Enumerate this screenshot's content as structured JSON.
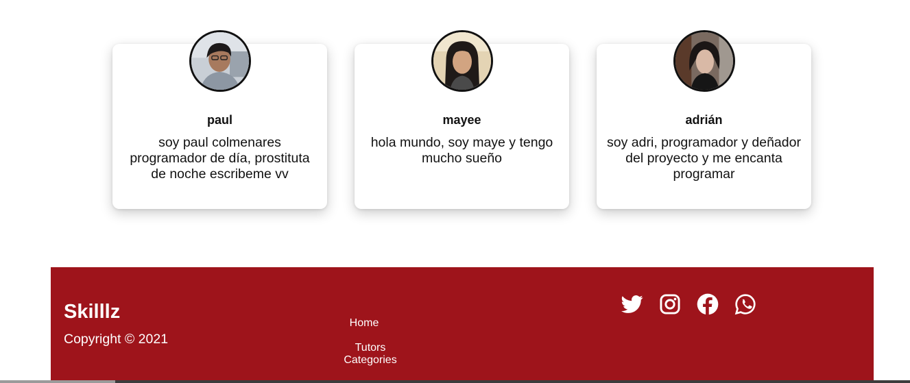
{
  "team": [
    {
      "name": "paul",
      "bio": "soy paul colmenares programador de día, prostituta de noche escribeme vv",
      "avatar_alt": "paul-photo"
    },
    {
      "name": "mayee",
      "bio": "hola mundo, soy maye y tengo mucho sueño",
      "avatar_alt": "mayee-photo"
    },
    {
      "name": "adrián",
      "bio": "soy adri, programador y deñador del proyecto y me encanta programar",
      "avatar_alt": "adrian-photo"
    }
  ],
  "footer": {
    "brand": "Skilllz",
    "copyright": "Copyright © 2021",
    "nav": {
      "home": "Home",
      "tutors_categories": "Tutors Categories"
    },
    "social": [
      "twitter-icon",
      "instagram-icon",
      "facebook-icon",
      "whatsapp-icon"
    ]
  },
  "colors": {
    "footer_bg": "#9e141b",
    "card_bg": "#ffffff",
    "text": "#111111"
  }
}
